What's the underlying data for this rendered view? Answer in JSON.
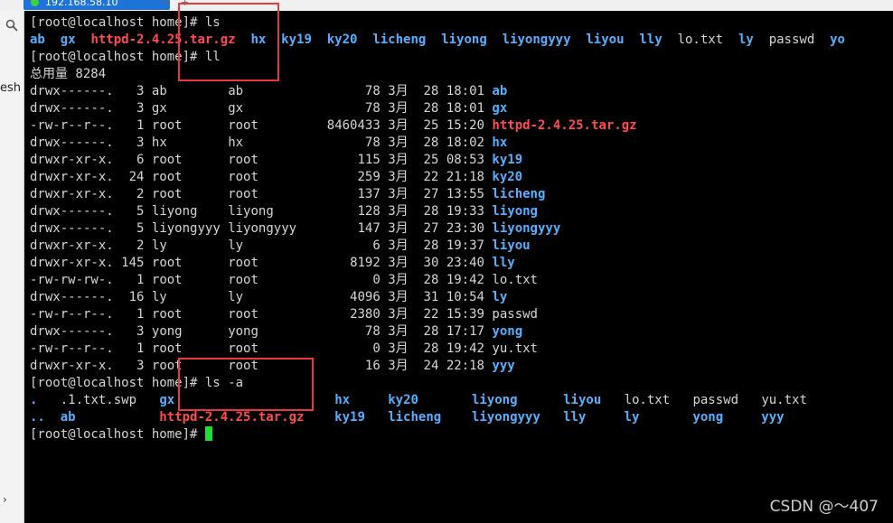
{
  "window": {
    "tab_title": "192.168.58.10",
    "tab_close": "×",
    "tab_add": "+",
    "sidebar_text": "esh",
    "sidebar_scroll": "›"
  },
  "colors": {
    "terminal_bg": "#000000",
    "text": "#d6d6d6",
    "directory_blue": "#56b0ff",
    "archive_red": "#ff4d4d",
    "cursor_green": "#22dd33",
    "annotation_red": "#e83a3a"
  },
  "terminal": {
    "prompt": "[root@localhost home]#",
    "cmd1": "ls",
    "ls1": [
      {
        "text": "ab",
        "type": "dir"
      },
      {
        "text": "gx",
        "type": "dir"
      },
      {
        "text": "httpd-2.4.25.tar.gz",
        "type": "archive"
      },
      {
        "text": "hx",
        "type": "dir"
      },
      {
        "text": "ky19",
        "type": "dir"
      },
      {
        "text": "ky20",
        "type": "dir"
      },
      {
        "text": "licheng",
        "type": "dir"
      },
      {
        "text": "liyong",
        "type": "dir"
      },
      {
        "text": "liyongyyy",
        "type": "dir"
      },
      {
        "text": "liyou",
        "type": "dir"
      },
      {
        "text": "lly",
        "type": "dir"
      },
      {
        "text": "lo.txt",
        "type": "file"
      },
      {
        "text": "ly",
        "type": "dir"
      },
      {
        "text": "passwd",
        "type": "file"
      },
      {
        "text": "yo",
        "type": "dir"
      }
    ],
    "cmd2": "ll",
    "total": "总用量 8284",
    "entries": [
      {
        "perms": "drwx------.",
        "links": "3",
        "owner": "ab",
        "group": "ab",
        "size": "78",
        "month": "3月",
        "day": "28",
        "time": "18:01",
        "name": "ab",
        "type": "dir"
      },
      {
        "perms": "drwx------.",
        "links": "3",
        "owner": "gx",
        "group": "gx",
        "size": "78",
        "month": "3月",
        "day": "28",
        "time": "18:01",
        "name": "gx",
        "type": "dir"
      },
      {
        "perms": "-rw-r--r--.",
        "links": "1",
        "owner": "root",
        "group": "root",
        "size": "8460433",
        "month": "3月",
        "day": "25",
        "time": "15:20",
        "name": "httpd-2.4.25.tar.gz",
        "type": "archive"
      },
      {
        "perms": "drwx------.",
        "links": "3",
        "owner": "hx",
        "group": "hx",
        "size": "78",
        "month": "3月",
        "day": "28",
        "time": "18:02",
        "name": "hx",
        "type": "dir"
      },
      {
        "perms": "drwxr-xr-x.",
        "links": "6",
        "owner": "root",
        "group": "root",
        "size": "115",
        "month": "3月",
        "day": "25",
        "time": "08:53",
        "name": "ky19",
        "type": "dir"
      },
      {
        "perms": "drwxr-xr-x.",
        "links": "24",
        "owner": "root",
        "group": "root",
        "size": "259",
        "month": "3月",
        "day": "22",
        "time": "21:18",
        "name": "ky20",
        "type": "dir"
      },
      {
        "perms": "drwxr-xr-x.",
        "links": "2",
        "owner": "root",
        "group": "root",
        "size": "137",
        "month": "3月",
        "day": "27",
        "time": "13:55",
        "name": "licheng",
        "type": "dir"
      },
      {
        "perms": "drwx------.",
        "links": "5",
        "owner": "liyong",
        "group": "liyong",
        "size": "128",
        "month": "3月",
        "day": "28",
        "time": "19:33",
        "name": "liyong",
        "type": "dir"
      },
      {
        "perms": "drwx------.",
        "links": "5",
        "owner": "liyongyyy",
        "group": "liyongyyy",
        "size": "147",
        "month": "3月",
        "day": "27",
        "time": "23:30",
        "name": "liyongyyy",
        "type": "dir"
      },
      {
        "perms": "drwxr-xr-x.",
        "links": "2",
        "owner": "ly",
        "group": "ly",
        "size": "6",
        "month": "3月",
        "day": "28",
        "time": "19:37",
        "name": "liyou",
        "type": "dir"
      },
      {
        "perms": "drwxr-xr-x.",
        "links": "145",
        "owner": "root",
        "group": "root",
        "size": "8192",
        "month": "3月",
        "day": "30",
        "time": "23:40",
        "name": "lly",
        "type": "dir"
      },
      {
        "perms": "-rw-rw-rw-.",
        "links": "1",
        "owner": "root",
        "group": "root",
        "size": "0",
        "month": "3月",
        "day": "28",
        "time": "19:42",
        "name": "lo.txt",
        "type": "file"
      },
      {
        "perms": "drwx------.",
        "links": "16",
        "owner": "ly",
        "group": "ly",
        "size": "4096",
        "month": "3月",
        "day": "31",
        "time": "10:54",
        "name": "ly",
        "type": "dir"
      },
      {
        "perms": "-rw-r--r--.",
        "links": "1",
        "owner": "root",
        "group": "root",
        "size": "2380",
        "month": "3月",
        "day": "22",
        "time": "15:39",
        "name": "passwd",
        "type": "file"
      },
      {
        "perms": "drwx------.",
        "links": "3",
        "owner": "yong",
        "group": "yong",
        "size": "78",
        "month": "3月",
        "day": "28",
        "time": "17:17",
        "name": "yong",
        "type": "dir"
      },
      {
        "perms": "-rw-r--r--.",
        "links": "1",
        "owner": "root",
        "group": "root",
        "size": "0",
        "month": "3月",
        "day": "28",
        "time": "19:42",
        "name": "yu.txt",
        "type": "file"
      },
      {
        "perms": "drwxr-xr-x.",
        "links": "3",
        "owner": "root",
        "group": "root",
        "size": "16",
        "month": "3月",
        "day": "24",
        "time": "22:18",
        "name": "yyy",
        "type": "dir"
      }
    ],
    "cmd3": "ls -a",
    "lsa_row1": [
      {
        "text": ".",
        "type": "dir"
      },
      {
        "text": ".1.txt.swp",
        "type": "file"
      },
      {
        "text": "gx",
        "type": "dir"
      },
      {
        "text": "hx",
        "type": "dir"
      },
      {
        "text": "ky20",
        "type": "dir"
      },
      {
        "text": "liyong",
        "type": "dir"
      },
      {
        "text": "liyou",
        "type": "dir"
      },
      {
        "text": "lo.txt",
        "type": "file"
      },
      {
        "text": "passwd",
        "type": "file"
      },
      {
        "text": "yu.txt",
        "type": "file"
      }
    ],
    "lsa_row2": [
      {
        "text": "..",
        "type": "dir"
      },
      {
        "text": "ab",
        "type": "dir"
      },
      {
        "text": "httpd-2.4.25.tar.gz",
        "type": "archive"
      },
      {
        "text": "ky19",
        "type": "dir"
      },
      {
        "text": "licheng",
        "type": "dir"
      },
      {
        "text": "liyongyyy",
        "type": "dir"
      },
      {
        "text": "lly",
        "type": "dir"
      },
      {
        "text": "ly",
        "type": "dir"
      },
      {
        "text": "yong",
        "type": "dir"
      },
      {
        "text": "yyy",
        "type": "dir"
      }
    ]
  },
  "watermark": "CSDN @～407"
}
